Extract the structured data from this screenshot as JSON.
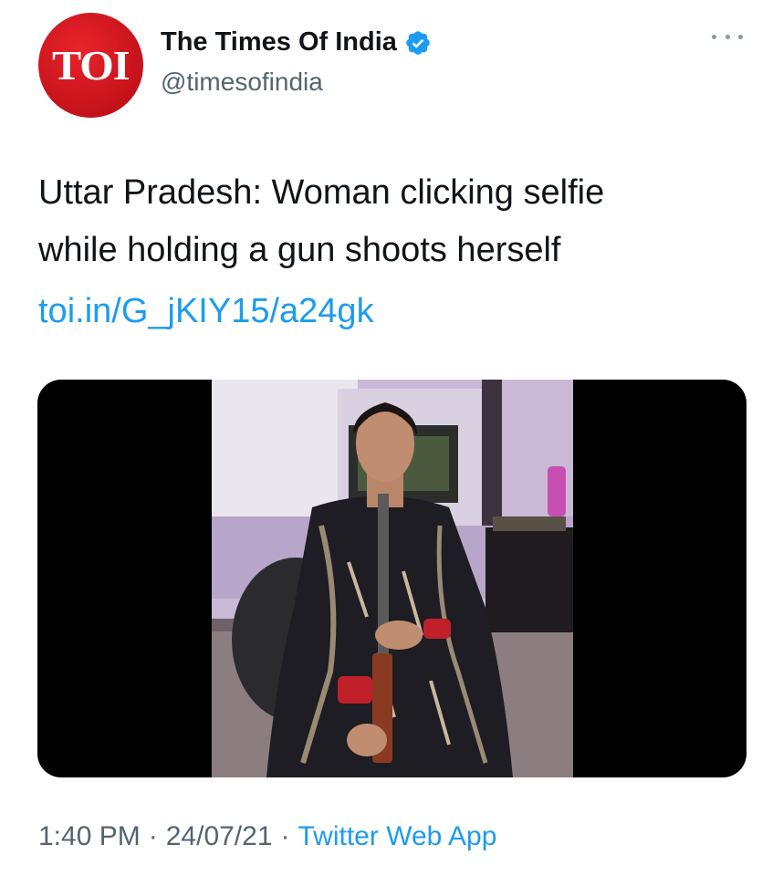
{
  "account": {
    "avatar_text": "TOI",
    "display_name": "The Times Of India",
    "handle": "@timesofindia",
    "verified_icon": "verified-badge-icon"
  },
  "tweet": {
    "text_lines": [
      "Uttar Pradesh: Woman clicking selfie",
      "while holding a gun shoots herself"
    ],
    "link": "toi.in/G_jKIY15/a24gk",
    "time": "1:40 PM",
    "date": "24/07/21",
    "separator": "·",
    "source": "Twitter Web App"
  },
  "media": {
    "description_icon": "photo-image"
  },
  "colors": {
    "brand_red": "#d5161e",
    "link_blue": "#1d9bf0",
    "muted_gray": "#536471"
  },
  "icons": {
    "more": "more-options-icon"
  }
}
